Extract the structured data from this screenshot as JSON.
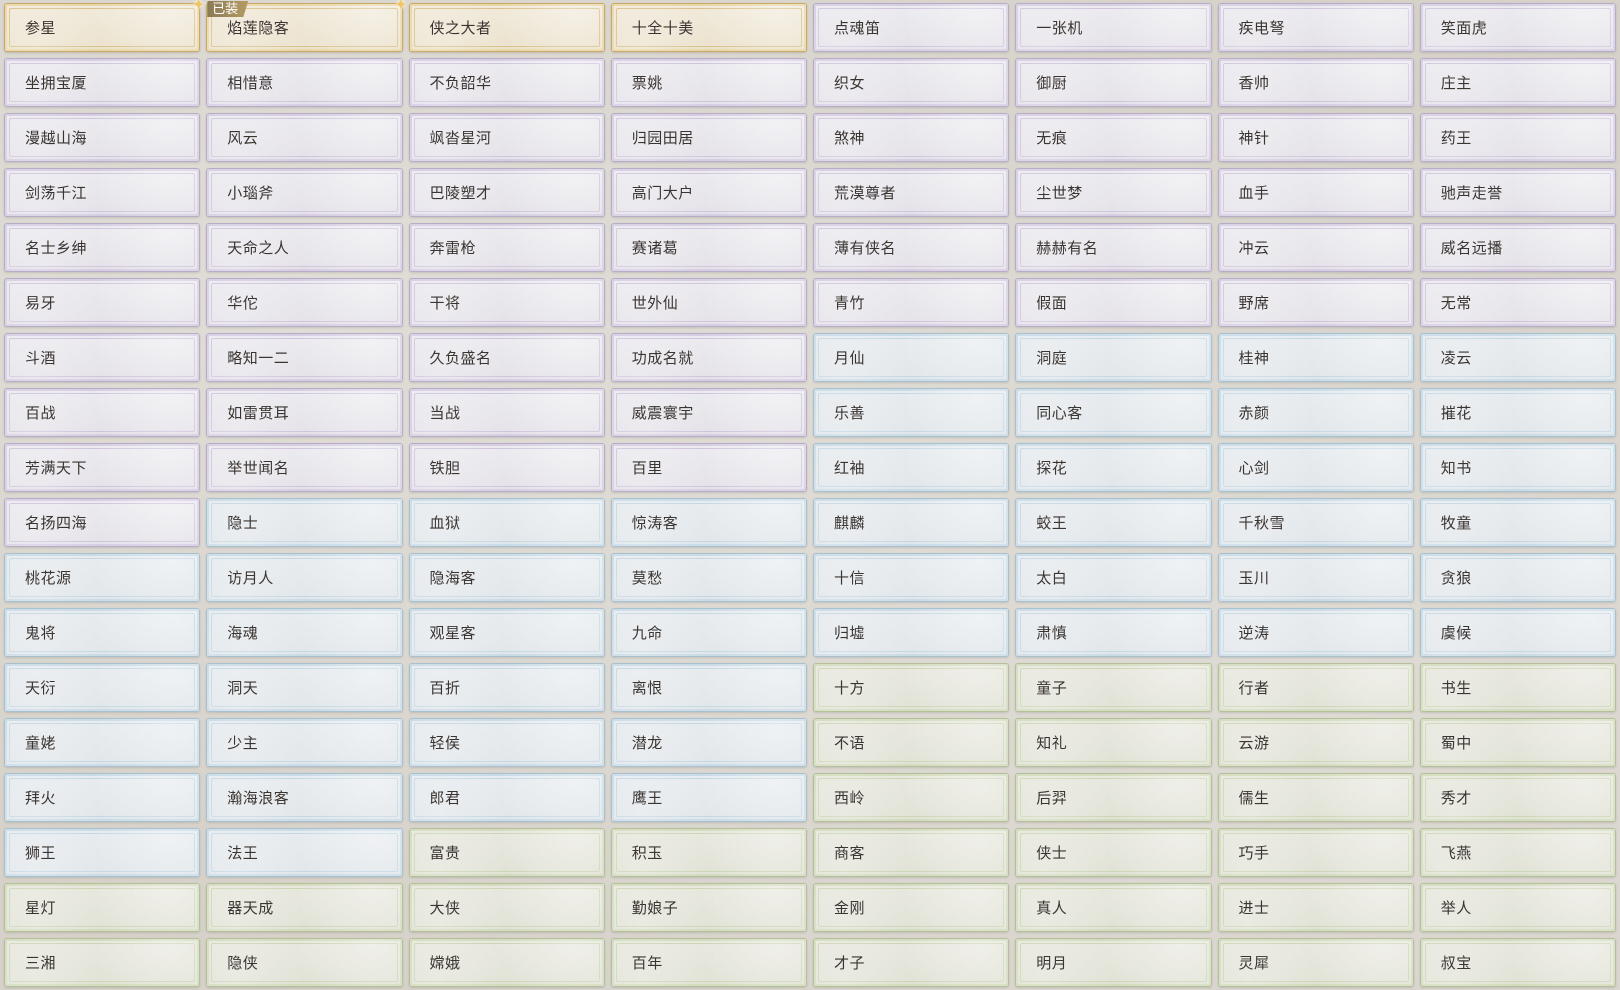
{
  "badges": {
    "equipped": "已装"
  },
  "titles": [
    {
      "label": "参星",
      "rarity": "gold",
      "sparkle": true
    },
    {
      "label": "焰莲隐客",
      "rarity": "gold",
      "sparkle": true,
      "equipped": true
    },
    {
      "label": "侠之大者",
      "rarity": "gold"
    },
    {
      "label": "十全十美",
      "rarity": "gold"
    },
    {
      "label": "点魂笛",
      "rarity": "purple"
    },
    {
      "label": "一张机",
      "rarity": "purple"
    },
    {
      "label": "疾电弩",
      "rarity": "purple"
    },
    {
      "label": "笑面虎",
      "rarity": "purple"
    },
    {
      "label": "坐拥宝厦",
      "rarity": "purple"
    },
    {
      "label": "相惜意",
      "rarity": "purple"
    },
    {
      "label": "不负韶华",
      "rarity": "purple"
    },
    {
      "label": "票姚",
      "rarity": "purple"
    },
    {
      "label": "织女",
      "rarity": "purple"
    },
    {
      "label": "御厨",
      "rarity": "purple"
    },
    {
      "label": "香帅",
      "rarity": "purple"
    },
    {
      "label": "庄主",
      "rarity": "purple"
    },
    {
      "label": "漫越山海",
      "rarity": "purple"
    },
    {
      "label": "风云",
      "rarity": "purple"
    },
    {
      "label": "飒沓星河",
      "rarity": "purple"
    },
    {
      "label": "归园田居",
      "rarity": "purple"
    },
    {
      "label": "煞神",
      "rarity": "purple"
    },
    {
      "label": "无痕",
      "rarity": "purple"
    },
    {
      "label": "神针",
      "rarity": "purple"
    },
    {
      "label": "药王",
      "rarity": "purple"
    },
    {
      "label": "剑荡千江",
      "rarity": "purple"
    },
    {
      "label": "小瑙斧",
      "rarity": "purple"
    },
    {
      "label": "巴陵塑才",
      "rarity": "purple"
    },
    {
      "label": "高门大户",
      "rarity": "purple"
    },
    {
      "label": "荒漠尊者",
      "rarity": "purple"
    },
    {
      "label": "尘世梦",
      "rarity": "purple"
    },
    {
      "label": "血手",
      "rarity": "purple"
    },
    {
      "label": "驰声走誉",
      "rarity": "purple"
    },
    {
      "label": "名士乡绅",
      "rarity": "purple"
    },
    {
      "label": "天命之人",
      "rarity": "purple"
    },
    {
      "label": "奔雷枪",
      "rarity": "purple"
    },
    {
      "label": "赛诸葛",
      "rarity": "purple"
    },
    {
      "label": "薄有侠名",
      "rarity": "purple"
    },
    {
      "label": "赫赫有名",
      "rarity": "purple"
    },
    {
      "label": "冲云",
      "rarity": "purple"
    },
    {
      "label": "威名远播",
      "rarity": "purple"
    },
    {
      "label": "易牙",
      "rarity": "purple"
    },
    {
      "label": "华佗",
      "rarity": "purple"
    },
    {
      "label": "干将",
      "rarity": "purple"
    },
    {
      "label": "世外仙",
      "rarity": "purple"
    },
    {
      "label": "青竹",
      "rarity": "purple"
    },
    {
      "label": "假面",
      "rarity": "purple"
    },
    {
      "label": "野席",
      "rarity": "purple"
    },
    {
      "label": "无常",
      "rarity": "purple"
    },
    {
      "label": "斗酒",
      "rarity": "purple"
    },
    {
      "label": "略知一二",
      "rarity": "purple"
    },
    {
      "label": "久负盛名",
      "rarity": "purple"
    },
    {
      "label": "功成名就",
      "rarity": "purple"
    },
    {
      "label": "月仙",
      "rarity": "blue"
    },
    {
      "label": "洞庭",
      "rarity": "blue"
    },
    {
      "label": "桂神",
      "rarity": "blue"
    },
    {
      "label": "凌云",
      "rarity": "blue"
    },
    {
      "label": "百战",
      "rarity": "purple"
    },
    {
      "label": "如雷贯耳",
      "rarity": "purple"
    },
    {
      "label": "当战",
      "rarity": "purple"
    },
    {
      "label": "威震寰宇",
      "rarity": "purple"
    },
    {
      "label": "乐善",
      "rarity": "blue"
    },
    {
      "label": "同心客",
      "rarity": "blue"
    },
    {
      "label": "赤颜",
      "rarity": "blue"
    },
    {
      "label": "摧花",
      "rarity": "blue"
    },
    {
      "label": "芳满天下",
      "rarity": "purple"
    },
    {
      "label": "举世闻名",
      "rarity": "purple"
    },
    {
      "label": "铁胆",
      "rarity": "purple"
    },
    {
      "label": "百里",
      "rarity": "purple"
    },
    {
      "label": "红袖",
      "rarity": "blue"
    },
    {
      "label": "探花",
      "rarity": "blue"
    },
    {
      "label": "心剑",
      "rarity": "blue"
    },
    {
      "label": "知书",
      "rarity": "blue"
    },
    {
      "label": "名扬四海",
      "rarity": "purple"
    },
    {
      "label": "隐士",
      "rarity": "blue"
    },
    {
      "label": "血狱",
      "rarity": "blue"
    },
    {
      "label": "惊涛客",
      "rarity": "blue"
    },
    {
      "label": "麒麟",
      "rarity": "blue"
    },
    {
      "label": "蛟王",
      "rarity": "blue"
    },
    {
      "label": "千秋雪",
      "rarity": "blue"
    },
    {
      "label": "牧童",
      "rarity": "blue"
    },
    {
      "label": "桃花源",
      "rarity": "blue"
    },
    {
      "label": "访月人",
      "rarity": "blue"
    },
    {
      "label": "隐海客",
      "rarity": "blue"
    },
    {
      "label": "莫愁",
      "rarity": "blue"
    },
    {
      "label": "十信",
      "rarity": "blue"
    },
    {
      "label": "太白",
      "rarity": "blue"
    },
    {
      "label": "玉川",
      "rarity": "blue"
    },
    {
      "label": "贪狼",
      "rarity": "blue"
    },
    {
      "label": "鬼将",
      "rarity": "blue"
    },
    {
      "label": "海魂",
      "rarity": "blue"
    },
    {
      "label": "观星客",
      "rarity": "blue"
    },
    {
      "label": "九命",
      "rarity": "blue"
    },
    {
      "label": "归墟",
      "rarity": "blue"
    },
    {
      "label": "肃慎",
      "rarity": "blue"
    },
    {
      "label": "逆涛",
      "rarity": "blue"
    },
    {
      "label": "虞候",
      "rarity": "blue"
    },
    {
      "label": "天衍",
      "rarity": "blue"
    },
    {
      "label": "洞天",
      "rarity": "blue"
    },
    {
      "label": "百折",
      "rarity": "blue"
    },
    {
      "label": "离恨",
      "rarity": "blue"
    },
    {
      "label": "十方",
      "rarity": "green"
    },
    {
      "label": "童子",
      "rarity": "green"
    },
    {
      "label": "行者",
      "rarity": "green"
    },
    {
      "label": "书生",
      "rarity": "green"
    },
    {
      "label": "童姥",
      "rarity": "blue"
    },
    {
      "label": "少主",
      "rarity": "blue"
    },
    {
      "label": "轻侯",
      "rarity": "blue"
    },
    {
      "label": "潜龙",
      "rarity": "blue"
    },
    {
      "label": "不语",
      "rarity": "green"
    },
    {
      "label": "知礼",
      "rarity": "green"
    },
    {
      "label": "云游",
      "rarity": "green"
    },
    {
      "label": "蜀中",
      "rarity": "green"
    },
    {
      "label": "拜火",
      "rarity": "blue"
    },
    {
      "label": "瀚海浪客",
      "rarity": "blue"
    },
    {
      "label": "郎君",
      "rarity": "blue"
    },
    {
      "label": "鹰王",
      "rarity": "blue"
    },
    {
      "label": "西岭",
      "rarity": "green"
    },
    {
      "label": "后羿",
      "rarity": "green"
    },
    {
      "label": "儒生",
      "rarity": "green"
    },
    {
      "label": "秀才",
      "rarity": "green"
    },
    {
      "label": "狮王",
      "rarity": "blue"
    },
    {
      "label": "法王",
      "rarity": "blue"
    },
    {
      "label": "富贵",
      "rarity": "green"
    },
    {
      "label": "积玉",
      "rarity": "green"
    },
    {
      "label": "商客",
      "rarity": "green"
    },
    {
      "label": "侠士",
      "rarity": "green"
    },
    {
      "label": "巧手",
      "rarity": "green"
    },
    {
      "label": "飞燕",
      "rarity": "green"
    },
    {
      "label": "星灯",
      "rarity": "green"
    },
    {
      "label": "器天成",
      "rarity": "green"
    },
    {
      "label": "大侠",
      "rarity": "green"
    },
    {
      "label": "勤娘子",
      "rarity": "green"
    },
    {
      "label": "金刚",
      "rarity": "green"
    },
    {
      "label": "真人",
      "rarity": "green"
    },
    {
      "label": "进士",
      "rarity": "green"
    },
    {
      "label": "举人",
      "rarity": "green"
    },
    {
      "label": "三湘",
      "rarity": "green"
    },
    {
      "label": "隐侠",
      "rarity": "green"
    },
    {
      "label": "嫦娥",
      "rarity": "green"
    },
    {
      "label": "百年",
      "rarity": "green"
    },
    {
      "label": "才子",
      "rarity": "green"
    },
    {
      "label": "明月",
      "rarity": "green"
    },
    {
      "label": "灵犀",
      "rarity": "green"
    },
    {
      "label": "叔宝",
      "rarity": "green"
    }
  ]
}
